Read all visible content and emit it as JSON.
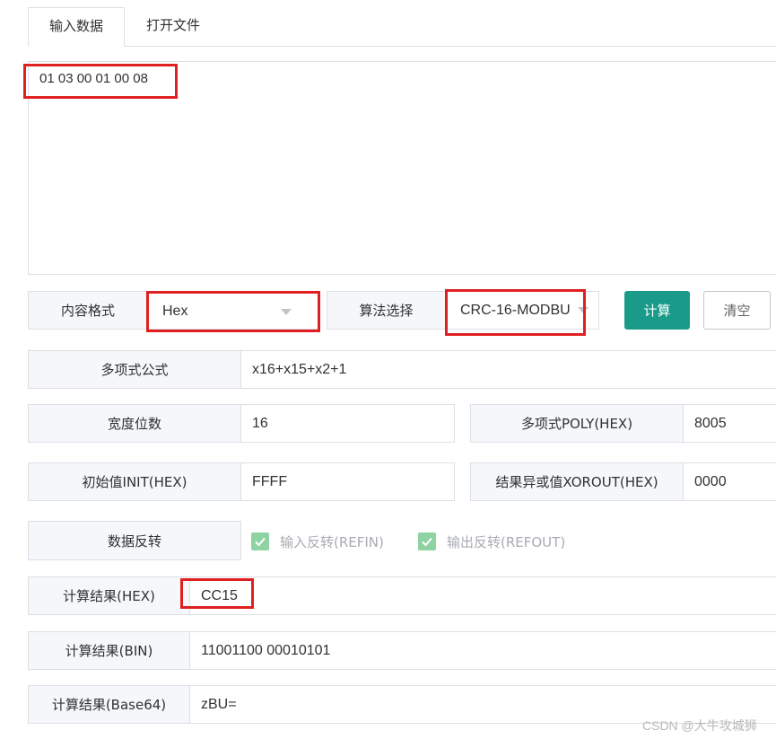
{
  "tabs": [
    {
      "label": "输入数据",
      "active": true
    },
    {
      "label": "打开文件",
      "active": false
    }
  ],
  "input": {
    "value": "01 03 00 01 00 08"
  },
  "format": {
    "label": "内容格式",
    "selected": "Hex"
  },
  "algorithm": {
    "label": "算法选择",
    "selected": "CRC-16-MODBU"
  },
  "buttons": {
    "calculate": "计算",
    "clear": "清空"
  },
  "polynomial_formula": {
    "label": "多项式公式",
    "value": "x16+x15+x2+1"
  },
  "width": {
    "label": "宽度位数",
    "value": "16"
  },
  "poly": {
    "label": "多项式POLY(HEX)",
    "value": "8005"
  },
  "init": {
    "label": "初始值INIT(HEX)",
    "value": "FFFF"
  },
  "xorout": {
    "label": "结果异或值XOROUT(HEX)",
    "value": "0000"
  },
  "reverse": {
    "label": "数据反转",
    "refin": {
      "label": "输入反转(REFIN)",
      "checked": true
    },
    "refout": {
      "label": "输出反转(REFOUT)",
      "checked": true
    }
  },
  "result_hex": {
    "label": "计算结果(HEX)",
    "value": "CC15"
  },
  "result_bin": {
    "label": "计算结果(BIN)",
    "value": "11001100 00010101"
  },
  "result_base64": {
    "label": "计算结果(Base64)",
    "value": "zBU="
  },
  "watermark": "CSDN @大牛攻城狮",
  "colors": {
    "primary": "#1a9b8a",
    "highlight": "#e02020",
    "checkbox": "#8fd3a3"
  }
}
